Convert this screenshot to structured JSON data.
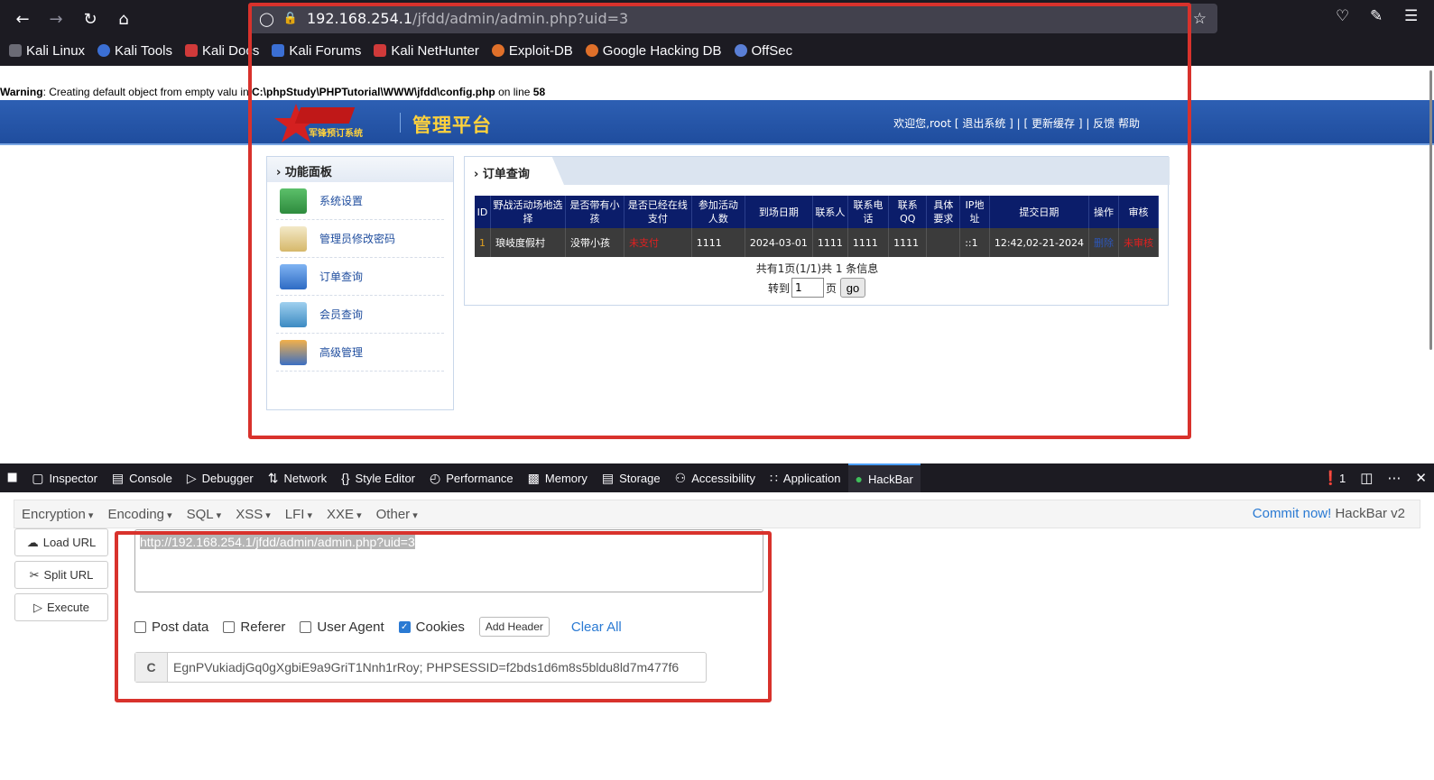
{
  "browser": {
    "url_host": "192.168.254.1",
    "url_path": "/jfdd/admin/admin.php?uid=3",
    "bookmarks": [
      "Kali Linux",
      "Kali Tools",
      "Kali Docs",
      "Kali Forums",
      "Kali NetHunter",
      "Exploit-DB",
      "Google Hacking DB",
      "OffSec"
    ]
  },
  "page": {
    "warning_label": "Warning",
    "warning_msg": ": Creating default object from empty valu",
    "warning_in": " in ",
    "warning_path": "C:\\phpStudy\\PHPTutorial\\WWW\\jfdd\\config.php",
    "warning_online": " on line ",
    "warning_line": "58",
    "logo_text": "军锋预订系统",
    "title": "管理平台",
    "top_links": "欢迎您,root [ 退出系统 ] | [ 更新缓存 ] |  反馈   帮助",
    "sidebar_title": "功能面板",
    "sidebar_items": [
      "系统设置",
      "管理员修改密码",
      "订单查询",
      "会员查询",
      "高级管理"
    ],
    "panel_title": "订单查询",
    "table_headers": [
      "ID",
      "野战活动场地选择",
      "是否带有小孩",
      "是否已经在线支付",
      "参加活动人数",
      "到场日期",
      "联系人",
      "联系电话",
      "联系QQ",
      "具体要求",
      "IP地址",
      "提交日期",
      "操作",
      "审核"
    ],
    "table_row": [
      "1",
      "琅岐度假村",
      "没带小孩",
      "未支付",
      "1111",
      "2024-03-01",
      "1111",
      "1111",
      "1111",
      "",
      "::1",
      "12:42,02-21-2024",
      "删除",
      "未审核"
    ],
    "pager_text": "共有1页(1/1)共 1  条信息",
    "goto_label": "转到",
    "goto_value": "1",
    "page_unit": "页",
    "go_label": "go"
  },
  "devtools": {
    "tabs": [
      "Inspector",
      "Console",
      "Debugger",
      "Network",
      "Style Editor",
      "Performance",
      "Memory",
      "Storage",
      "Accessibility",
      "Application",
      "HackBar"
    ],
    "error_count": "1"
  },
  "hackbar": {
    "menus": [
      "Encryption",
      "Encoding",
      "SQL",
      "XSS",
      "LFI",
      "XXE",
      "Other"
    ],
    "commit": "Commit now!",
    "version": "HackBar v2",
    "load_url": "Load URL",
    "split_url": "Split URL",
    "execute": "Execute",
    "url_value": "http://192.168.254.1/jfdd/admin/admin.php?uid=3",
    "options": [
      "Post data",
      "Referer",
      "User Agent",
      "Cookies"
    ],
    "add_header": "Add Header",
    "clear_all": "Clear All",
    "cookie_label": "C",
    "cookie_value": "EgnPVukiadjGq0gXgbiE9a9GriT1Nnh1rRoy; PHPSESSID=f2bds1d6m8s5bldu8ld7m477f6"
  },
  "colors": {
    "accent_red": "#d8322c",
    "banner": "#1f4d9e",
    "table_header": "#0b1d6a",
    "hackbar_link": "#2a7ad3"
  }
}
